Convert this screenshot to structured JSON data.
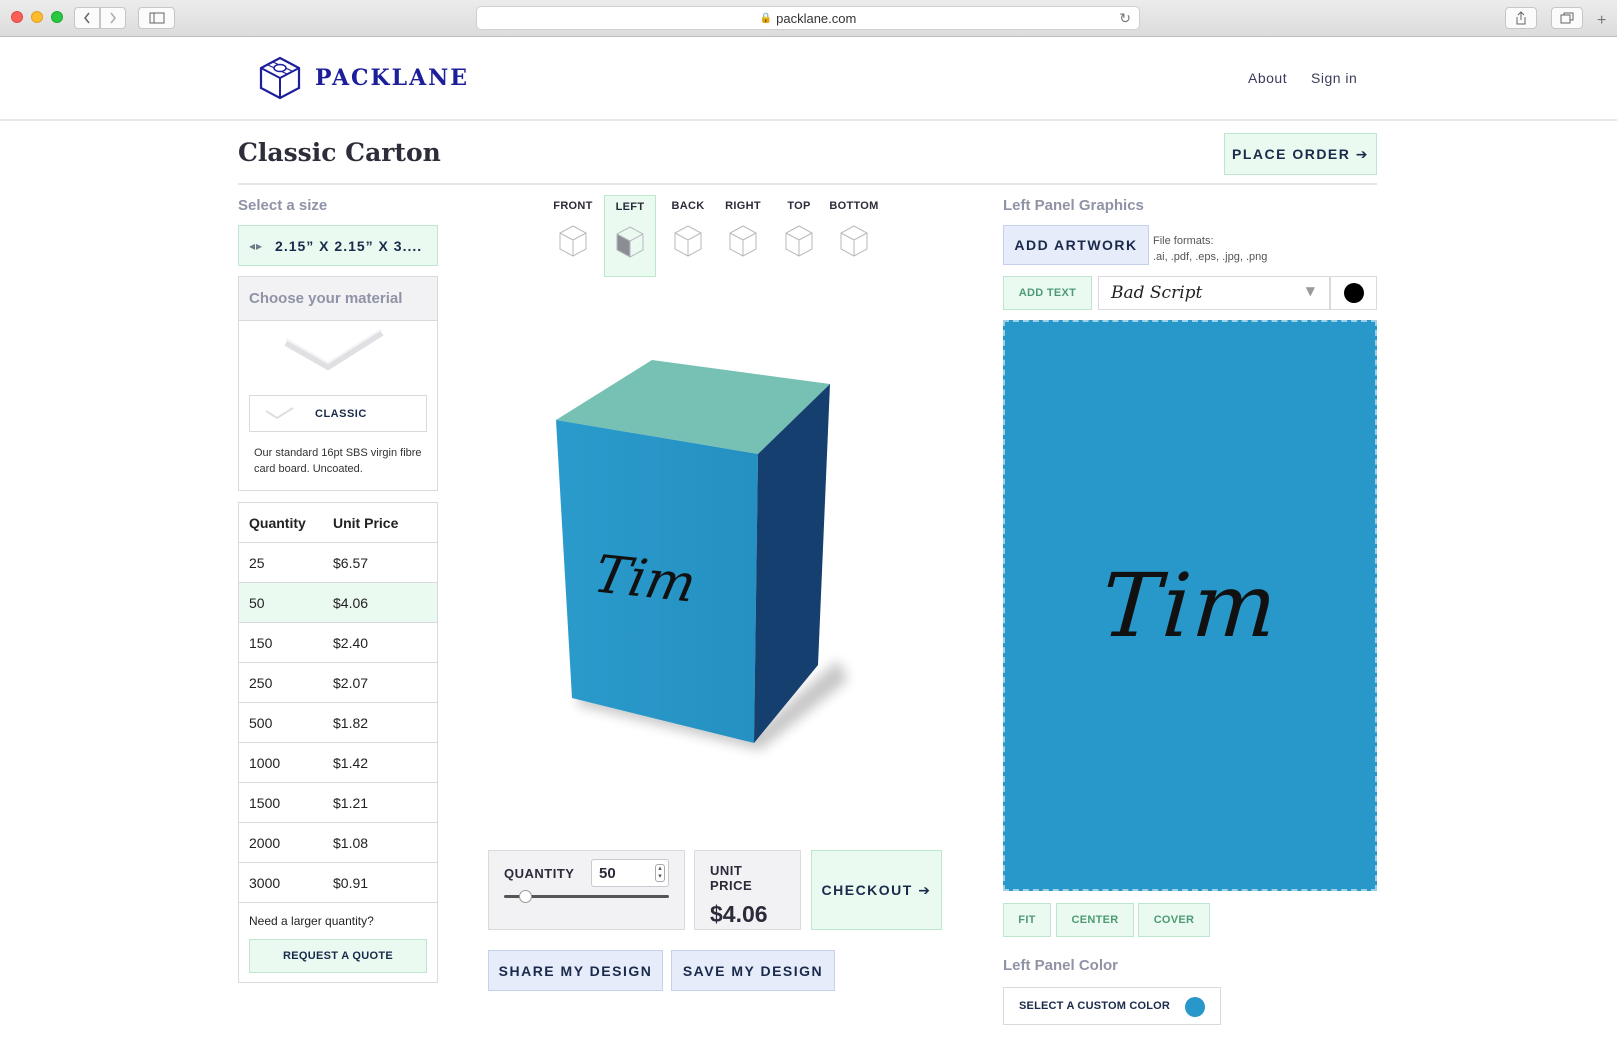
{
  "browser": {
    "url": "packlane.com"
  },
  "header": {
    "brand": "PACKLANE",
    "nav": [
      "About",
      "Sign in"
    ]
  },
  "page": {
    "title": "Classic Carton",
    "place_order": "PLACE ORDER ➔"
  },
  "left": {
    "size_label": "Select a size",
    "size_value": "2.15” X 2.15” X 3....",
    "material_heading": "Choose your material",
    "material_option": "CLASSIC",
    "material_description": "Our standard 16pt SBS virgin fibre card board. Uncoated.",
    "table": {
      "headers": [
        "Quantity",
        "Unit Price"
      ],
      "rows": [
        {
          "qty": "25",
          "price": "$6.57"
        },
        {
          "qty": "50",
          "price": "$4.06"
        },
        {
          "qty": "150",
          "price": "$2.40"
        },
        {
          "qty": "250",
          "price": "$2.07"
        },
        {
          "qty": "500",
          "price": "$1.82"
        },
        {
          "qty": "1000",
          "price": "$1.42"
        },
        {
          "qty": "1500",
          "price": "$1.21"
        },
        {
          "qty": "2000",
          "price": "$1.08"
        },
        {
          "qty": "3000",
          "price": "$0.91"
        }
      ],
      "selected_qty": "50"
    },
    "larger_quantity": "Need a larger quantity?",
    "request_quote": "REQUEST A QUOTE"
  },
  "center": {
    "views": [
      "FRONT",
      "LEFT",
      "BACK",
      "RIGHT",
      "TOP",
      "BOTTOM"
    ],
    "active_view": "LEFT",
    "box_text": "Tim",
    "quantity_label": "QUANTITY",
    "quantity_value": "50",
    "quantity_slider_fraction": 0.13,
    "unit_price_label": "UNIT PRICE",
    "unit_price_value": "$4.06",
    "checkout": "CHECKOUT ➔",
    "share": "SHARE MY DESIGN",
    "save": "SAVE MY DESIGN"
  },
  "right": {
    "graphics_label": "Left Panel Graphics",
    "add_artwork": "ADD ARTWORK",
    "formats_title": "File formats:",
    "formats_list": ".ai, .pdf, .eps, .jpg, .png",
    "add_text": "ADD TEXT",
    "font_name": "Bad Script",
    "text_color": "#000000",
    "canvas_color": "#2798c9",
    "canvas_text": "Tim",
    "align_buttons": [
      "FIT",
      "CENTER",
      "COVER"
    ],
    "color_label": "Left Panel Color",
    "custom_color": "SELECT A CUSTOM COLOR"
  },
  "colors": {
    "brand": "#1d1f9a",
    "mint": "#eafaf1",
    "box_blue": "#2798c9",
    "box_dark": "#153f6f",
    "box_top": "#76c1b4"
  }
}
